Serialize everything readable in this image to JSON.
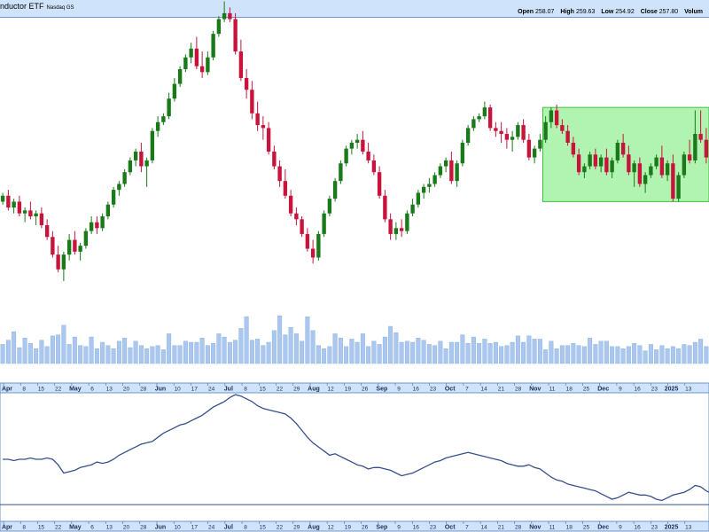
{
  "header": {
    "title": "nductor ETF",
    "exchange": "Nasdaq GS",
    "ohlc": [
      {
        "label": "Open",
        "value": "258.07"
      },
      {
        "label": "High",
        "value": "259.63"
      },
      {
        "label": "Low",
        "value": "254.92"
      },
      {
        "label": "Close",
        "value": "257.80"
      },
      {
        "label": "Volum",
        "value": ""
      }
    ]
  },
  "colors": {
    "up": "#1a7a1a",
    "down": "#c8143c",
    "volume": "#a9c7ef",
    "volume_edge": "#7aa2d6",
    "line": "#36508c",
    "panel_border": "#6f95c9",
    "axis_bg": "#cfe4fb",
    "box_fill": "#90ee90",
    "box_edge": "#3fbf3f"
  },
  "chart_data": [
    {
      "type": "candlestick",
      "title": "",
      "ylim": [
        0,
        100
      ],
      "grid": false,
      "annotation": "green rectangle spanning Oct 14 2024 to the right edge, y 55 to 87 (consolidation range)",
      "box": {
        "x_from": "2024-10-14",
        "x_to": "2025-01-17",
        "y_low": 55,
        "y_high": 87
      },
      "candles": [
        {
          "o": 55,
          "h": 58,
          "l": 54,
          "c": 57
        },
        {
          "o": 57,
          "h": 59,
          "l": 52,
          "c": 53
        },
        {
          "o": 53,
          "h": 56,
          "l": 51,
          "c": 55
        },
        {
          "o": 55,
          "h": 57,
          "l": 50,
          "c": 51
        },
        {
          "o": 51,
          "h": 53,
          "l": 48,
          "c": 52
        },
        {
          "o": 52,
          "h": 55,
          "l": 49,
          "c": 50
        },
        {
          "o": 50,
          "h": 52,
          "l": 47,
          "c": 51
        },
        {
          "o": 51,
          "h": 53,
          "l": 46,
          "c": 47
        },
        {
          "o": 47,
          "h": 49,
          "l": 42,
          "c": 43
        },
        {
          "o": 43,
          "h": 45,
          "l": 36,
          "c": 37
        },
        {
          "o": 37,
          "h": 40,
          "l": 31,
          "c": 32
        },
        {
          "o": 32,
          "h": 38,
          "l": 28,
          "c": 37
        },
        {
          "o": 37,
          "h": 44,
          "l": 35,
          "c": 42
        },
        {
          "o": 42,
          "h": 45,
          "l": 37,
          "c": 38
        },
        {
          "o": 38,
          "h": 41,
          "l": 35,
          "c": 40
        },
        {
          "o": 40,
          "h": 46,
          "l": 39,
          "c": 45
        },
        {
          "o": 45,
          "h": 50,
          "l": 44,
          "c": 48
        },
        {
          "o": 48,
          "h": 50,
          "l": 44,
          "c": 46
        },
        {
          "o": 46,
          "h": 51,
          "l": 45,
          "c": 50
        },
        {
          "o": 50,
          "h": 55,
          "l": 49,
          "c": 54
        },
        {
          "o": 54,
          "h": 60,
          "l": 53,
          "c": 59
        },
        {
          "o": 59,
          "h": 62,
          "l": 57,
          "c": 61
        },
        {
          "o": 61,
          "h": 66,
          "l": 60,
          "c": 65
        },
        {
          "o": 65,
          "h": 70,
          "l": 64,
          "c": 69
        },
        {
          "o": 69,
          "h": 73,
          "l": 67,
          "c": 72
        },
        {
          "o": 72,
          "h": 75,
          "l": 65,
          "c": 67
        },
        {
          "o": 67,
          "h": 70,
          "l": 60,
          "c": 69
        },
        {
          "o": 69,
          "h": 80,
          "l": 68,
          "c": 79
        },
        {
          "o": 79,
          "h": 84,
          "l": 77,
          "c": 82
        },
        {
          "o": 82,
          "h": 85,
          "l": 81,
          "c": 84
        },
        {
          "o": 84,
          "h": 92,
          "l": 83,
          "c": 90
        },
        {
          "o": 90,
          "h": 97,
          "l": 89,
          "c": 95
        },
        {
          "o": 95,
          "h": 101,
          "l": 94,
          "c": 100
        },
        {
          "o": 100,
          "h": 105,
          "l": 99,
          "c": 104
        },
        {
          "o": 104,
          "h": 109,
          "l": 102,
          "c": 107
        },
        {
          "o": 107,
          "h": 111,
          "l": 100,
          "c": 101
        },
        {
          "o": 101,
          "h": 106,
          "l": 97,
          "c": 99
        },
        {
          "o": 99,
          "h": 106,
          "l": 98,
          "c": 104
        },
        {
          "o": 104,
          "h": 113,
          "l": 103,
          "c": 112
        },
        {
          "o": 112,
          "h": 118,
          "l": 111,
          "c": 117
        },
        {
          "o": 117,
          "h": 123,
          "l": 116,
          "c": 119
        },
        {
          "o": 119,
          "h": 121,
          "l": 116,
          "c": 117
        },
        {
          "o": 117,
          "h": 119,
          "l": 105,
          "c": 106
        },
        {
          "o": 106,
          "h": 110,
          "l": 96,
          "c": 97
        },
        {
          "o": 97,
          "h": 100,
          "l": 90,
          "c": 93
        },
        {
          "o": 93,
          "h": 96,
          "l": 83,
          "c": 85
        },
        {
          "o": 85,
          "h": 89,
          "l": 79,
          "c": 81
        },
        {
          "o": 81,
          "h": 84,
          "l": 76,
          "c": 80
        },
        {
          "o": 80,
          "h": 82,
          "l": 71,
          "c": 72
        },
        {
          "o": 72,
          "h": 74,
          "l": 66,
          "c": 67
        },
        {
          "o": 67,
          "h": 69,
          "l": 60,
          "c": 62
        },
        {
          "o": 62,
          "h": 66,
          "l": 56,
          "c": 57
        },
        {
          "o": 57,
          "h": 59,
          "l": 50,
          "c": 51
        },
        {
          "o": 51,
          "h": 53,
          "l": 47,
          "c": 49
        },
        {
          "o": 49,
          "h": 50,
          "l": 43,
          "c": 44
        },
        {
          "o": 44,
          "h": 46,
          "l": 38,
          "c": 39
        },
        {
          "o": 39,
          "h": 42,
          "l": 34,
          "c": 36
        },
        {
          "o": 36,
          "h": 45,
          "l": 35,
          "c": 44
        },
        {
          "o": 44,
          "h": 52,
          "l": 43,
          "c": 51
        },
        {
          "o": 51,
          "h": 57,
          "l": 50,
          "c": 56
        },
        {
          "o": 56,
          "h": 63,
          "l": 55,
          "c": 62
        },
        {
          "o": 62,
          "h": 69,
          "l": 61,
          "c": 68
        },
        {
          "o": 68,
          "h": 74,
          "l": 67,
          "c": 73
        },
        {
          "o": 73,
          "h": 76,
          "l": 71,
          "c": 75
        },
        {
          "o": 75,
          "h": 78,
          "l": 73,
          "c": 76
        },
        {
          "o": 76,
          "h": 79,
          "l": 71,
          "c": 72
        },
        {
          "o": 72,
          "h": 75,
          "l": 68,
          "c": 69
        },
        {
          "o": 69,
          "h": 71,
          "l": 64,
          "c": 65
        },
        {
          "o": 65,
          "h": 67,
          "l": 56,
          "c": 57
        },
        {
          "o": 57,
          "h": 59,
          "l": 48,
          "c": 49
        },
        {
          "o": 49,
          "h": 51,
          "l": 42,
          "c": 44
        },
        {
          "o": 44,
          "h": 48,
          "l": 42,
          "c": 46
        },
        {
          "o": 46,
          "h": 49,
          "l": 43,
          "c": 45
        },
        {
          "o": 45,
          "h": 52,
          "l": 44,
          "c": 51
        },
        {
          "o": 51,
          "h": 56,
          "l": 50,
          "c": 54
        },
        {
          "o": 54,
          "h": 59,
          "l": 53,
          "c": 58
        },
        {
          "o": 58,
          "h": 61,
          "l": 56,
          "c": 60
        },
        {
          "o": 60,
          "h": 63,
          "l": 58,
          "c": 61
        },
        {
          "o": 61,
          "h": 65,
          "l": 60,
          "c": 64
        },
        {
          "o": 64,
          "h": 68,
          "l": 63,
          "c": 67
        },
        {
          "o": 67,
          "h": 70,
          "l": 65,
          "c": 69
        },
        {
          "o": 69,
          "h": 72,
          "l": 61,
          "c": 62
        },
        {
          "o": 62,
          "h": 69,
          "l": 60,
          "c": 68
        },
        {
          "o": 68,
          "h": 76,
          "l": 67,
          "c": 75
        },
        {
          "o": 75,
          "h": 81,
          "l": 74,
          "c": 80
        },
        {
          "o": 80,
          "h": 84,
          "l": 79,
          "c": 83
        },
        {
          "o": 83,
          "h": 85,
          "l": 82,
          "c": 84
        },
        {
          "o": 84,
          "h": 89,
          "l": 83,
          "c": 87
        },
        {
          "o": 87,
          "h": 88,
          "l": 79,
          "c": 80
        },
        {
          "o": 80,
          "h": 82,
          "l": 77,
          "c": 79
        },
        {
          "o": 79,
          "h": 82,
          "l": 75,
          "c": 78
        },
        {
          "o": 78,
          "h": 80,
          "l": 73,
          "c": 76
        },
        {
          "o": 76,
          "h": 79,
          "l": 72,
          "c": 77
        },
        {
          "o": 77,
          "h": 82,
          "l": 76,
          "c": 81
        },
        {
          "o": 81,
          "h": 83,
          "l": 75,
          "c": 76
        },
        {
          "o": 76,
          "h": 78,
          "l": 69,
          "c": 70
        },
        {
          "o": 70,
          "h": 74,
          "l": 68,
          "c": 73
        },
        {
          "o": 73,
          "h": 78,
          "l": 72,
          "c": 76
        },
        {
          "o": 76,
          "h": 84,
          "l": 75,
          "c": 82
        },
        {
          "o": 82,
          "h": 87,
          "l": 80,
          "c": 86
        },
        {
          "o": 86,
          "h": 88,
          "l": 80,
          "c": 81
        },
        {
          "o": 81,
          "h": 83,
          "l": 78,
          "c": 79
        },
        {
          "o": 79,
          "h": 81,
          "l": 74,
          "c": 75
        },
        {
          "o": 75,
          "h": 77,
          "l": 70,
          "c": 71
        },
        {
          "o": 71,
          "h": 73,
          "l": 64,
          "c": 65
        },
        {
          "o": 65,
          "h": 68,
          "l": 63,
          "c": 67
        },
        {
          "o": 67,
          "h": 72,
          "l": 66,
          "c": 71
        },
        {
          "o": 71,
          "h": 73,
          "l": 66,
          "c": 67
        },
        {
          "o": 67,
          "h": 71,
          "l": 65,
          "c": 70
        },
        {
          "o": 70,
          "h": 73,
          "l": 64,
          "c": 65
        },
        {
          "o": 65,
          "h": 70,
          "l": 63,
          "c": 69
        },
        {
          "o": 69,
          "h": 76,
          "l": 68,
          "c": 75
        },
        {
          "o": 75,
          "h": 78,
          "l": 70,
          "c": 71
        },
        {
          "o": 71,
          "h": 74,
          "l": 64,
          "c": 65
        },
        {
          "o": 65,
          "h": 69,
          "l": 60,
          "c": 68
        },
        {
          "o": 68,
          "h": 70,
          "l": 60,
          "c": 61
        },
        {
          "o": 61,
          "h": 65,
          "l": 58,
          "c": 64
        },
        {
          "o": 64,
          "h": 68,
          "l": 63,
          "c": 67
        },
        {
          "o": 67,
          "h": 71,
          "l": 66,
          "c": 70
        },
        {
          "o": 70,
          "h": 74,
          "l": 63,
          "c": 64
        },
        {
          "o": 64,
          "h": 69,
          "l": 62,
          "c": 68
        },
        {
          "o": 68,
          "h": 71,
          "l": 55,
          "c": 56
        },
        {
          "o": 56,
          "h": 65,
          "l": 55,
          "c": 64
        },
        {
          "o": 64,
          "h": 72,
          "l": 63,
          "c": 71
        },
        {
          "o": 71,
          "h": 76,
          "l": 68,
          "c": 69
        },
        {
          "o": 69,
          "h": 86,
          "l": 68,
          "c": 78
        },
        {
          "o": 78,
          "h": 86,
          "l": 75,
          "c": 76
        },
        {
          "o": 76,
          "h": 80,
          "l": 68,
          "c": 70
        }
      ]
    },
    {
      "type": "bar",
      "title": "",
      "series_name": "",
      "values": [
        18,
        22,
        30,
        15,
        24,
        19,
        14,
        22,
        16,
        26,
        27,
        36,
        18,
        25,
        17,
        16,
        25,
        14,
        20,
        17,
        14,
        21,
        24,
        15,
        21,
        17,
        14,
        16,
        17,
        13,
        28,
        17,
        17,
        21,
        20,
        20,
        24,
        17,
        19,
        28,
        25,
        20,
        22,
        33,
        44,
        22,
        23,
        17,
        20,
        31,
        45,
        27,
        34,
        28,
        21,
        44,
        31,
        17,
        14,
        16,
        28,
        24,
        16,
        23,
        20,
        28,
        16,
        21,
        18,
        25,
        35,
        29,
        20,
        21,
        20,
        24,
        22,
        18,
        17,
        21,
        14,
        20,
        20,
        27,
        19,
        25,
        19,
        23,
        19,
        20,
        16,
        17,
        20,
        26,
        20,
        26,
        23,
        23,
        13,
        21,
        14,
        17,
        17,
        19,
        17,
        16,
        24,
        18,
        21,
        21,
        16,
        16,
        14,
        16,
        19,
        17,
        12,
        18,
        13,
        17,
        14,
        16,
        14,
        18,
        17,
        20,
        23,
        16,
        10
      ],
      "ylim": [
        0,
        50
      ]
    },
    {
      "type": "line",
      "title": "",
      "series_name": "",
      "reference_line": 7,
      "values": [
        40,
        40,
        39,
        40,
        40,
        41,
        40,
        40,
        41,
        40,
        36,
        30,
        31,
        32,
        34,
        35,
        36,
        38,
        37,
        38,
        40,
        43,
        45,
        47,
        49,
        51,
        52,
        53,
        56,
        59,
        61,
        63,
        65,
        66,
        68,
        70,
        72,
        75,
        78,
        80,
        82,
        85,
        87,
        86,
        84,
        82,
        79,
        77,
        76,
        75,
        74,
        73,
        70,
        66,
        61,
        56,
        52,
        49,
        46,
        43,
        44,
        42,
        40,
        38,
        36,
        35,
        33,
        34,
        34,
        33,
        32,
        30,
        28,
        29,
        30,
        32,
        34,
        36,
        38,
        39,
        41,
        42,
        43,
        44,
        45,
        44,
        43,
        42,
        41,
        40,
        39,
        37,
        36,
        35,
        35,
        36,
        34,
        33,
        30,
        27,
        25,
        24,
        22,
        21,
        20,
        19,
        18,
        17,
        15,
        13,
        11,
        12,
        14,
        16,
        15,
        14,
        14,
        13,
        11,
        10,
        12,
        14,
        15,
        16,
        18,
        21,
        20,
        17,
        15
      ]
    }
  ],
  "x_axis_labels": [
    {
      "text": "Apr",
      "bold": true
    },
    {
      "text": "8",
      "bold": false
    },
    {
      "text": "15",
      "bold": false
    },
    {
      "text": "22",
      "bold": false
    },
    {
      "text": "May",
      "bold": true
    },
    {
      "text": "6",
      "bold": false
    },
    {
      "text": "13",
      "bold": false
    },
    {
      "text": "20",
      "bold": false
    },
    {
      "text": "28",
      "bold": false
    },
    {
      "text": "Jun",
      "bold": true
    },
    {
      "text": "10",
      "bold": false
    },
    {
      "text": "17",
      "bold": false
    },
    {
      "text": "24",
      "bold": false
    },
    {
      "text": "Jul",
      "bold": true
    },
    {
      "text": "8",
      "bold": false
    },
    {
      "text": "15",
      "bold": false
    },
    {
      "text": "22",
      "bold": false
    },
    {
      "text": "29",
      "bold": false
    },
    {
      "text": "Aug",
      "bold": true
    },
    {
      "text": "12",
      "bold": false
    },
    {
      "text": "19",
      "bold": false
    },
    {
      "text": "26",
      "bold": false
    },
    {
      "text": "Sep",
      "bold": true
    },
    {
      "text": "9",
      "bold": false
    },
    {
      "text": "16",
      "bold": false
    },
    {
      "text": "23",
      "bold": false
    },
    {
      "text": "Oct",
      "bold": true
    },
    {
      "text": "7",
      "bold": false
    },
    {
      "text": "14",
      "bold": false
    },
    {
      "text": "21",
      "bold": false
    },
    {
      "text": "28",
      "bold": false
    },
    {
      "text": "Nov",
      "bold": true
    },
    {
      "text": "11",
      "bold": false
    },
    {
      "text": "18",
      "bold": false
    },
    {
      "text": "25",
      "bold": false
    },
    {
      "text": "Dec",
      "bold": true
    },
    {
      "text": "9",
      "bold": false
    },
    {
      "text": "16",
      "bold": false
    },
    {
      "text": "23",
      "bold": false
    },
    {
      "text": "2025",
      "bold": true
    },
    {
      "text": "13",
      "bold": false
    }
  ]
}
